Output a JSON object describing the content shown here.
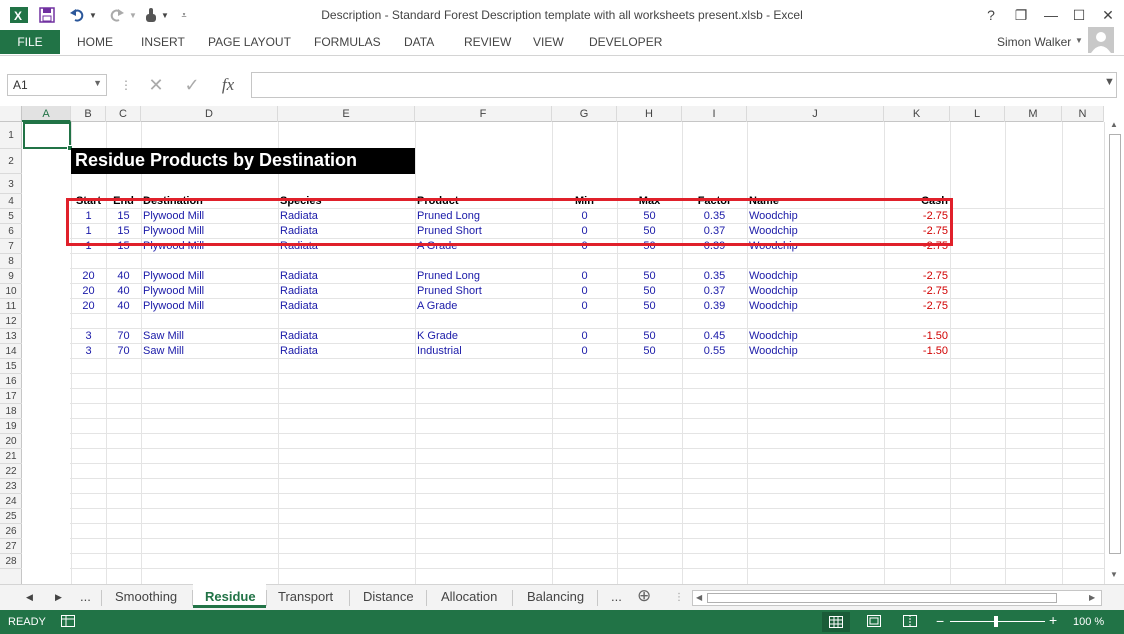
{
  "window": {
    "title": "Description - Standard Forest Description template with all worksheets present.xlsb - Excel",
    "help": "?",
    "restore_ribbon": "❐",
    "minimize": "—",
    "maximize": "☐",
    "close": "✕"
  },
  "ribbon": {
    "file": "FILE",
    "tabs": [
      "HOME",
      "INSERT",
      "PAGE LAYOUT",
      "FORMULAS",
      "DATA",
      "REVIEW",
      "VIEW",
      "DEVELOPER"
    ],
    "user": "Simon Walker"
  },
  "formula_bar": {
    "name_box": "A1",
    "fx": "fx",
    "formula": ""
  },
  "columns": [
    "A",
    "B",
    "C",
    "D",
    "E",
    "F",
    "G",
    "H",
    "I",
    "J",
    "K",
    "L",
    "M",
    "N"
  ],
  "rows": [
    "1",
    "2",
    "3",
    "4",
    "5",
    "6",
    "7",
    "8",
    "9",
    "10",
    "11",
    "12",
    "13",
    "14",
    "15",
    "16",
    "17",
    "18",
    "19",
    "20",
    "21",
    "22",
    "23",
    "24",
    "25",
    "26",
    "27",
    "28"
  ],
  "sheet": {
    "title": "Residue Products by Destination",
    "headers": {
      "start": "Start",
      "end": "End",
      "destination": "Destination",
      "species": "Species",
      "product": "Product",
      "min": "Min",
      "max": "Max",
      "factor": "Factor",
      "name": "Name",
      "cash": "Cash"
    },
    "data_rows": [
      {
        "start": "1",
        "end": "15",
        "destination": "Plywood Mill",
        "species": "Radiata",
        "product": "Pruned Long",
        "min": "0",
        "max": "50",
        "factor": "0.35",
        "name": "Woodchip",
        "cash": "-2.75"
      },
      {
        "start": "1",
        "end": "15",
        "destination": "Plywood Mill",
        "species": "Radiata",
        "product": "Pruned Short",
        "min": "0",
        "max": "50",
        "factor": "0.37",
        "name": "Woodchip",
        "cash": "-2.75"
      },
      {
        "start": "1",
        "end": "15",
        "destination": "Plywood Mill",
        "species": "Radiata",
        "product": "A Grade",
        "min": "0",
        "max": "50",
        "factor": "0.39",
        "name": "Woodchip",
        "cash": "-2.75"
      },
      {
        "start": "20",
        "end": "40",
        "destination": "Plywood Mill",
        "species": "Radiata",
        "product": "Pruned Long",
        "min": "0",
        "max": "50",
        "factor": "0.35",
        "name": "Woodchip",
        "cash": "-2.75"
      },
      {
        "start": "20",
        "end": "40",
        "destination": "Plywood Mill",
        "species": "Radiata",
        "product": "Pruned Short",
        "min": "0",
        "max": "50",
        "factor": "0.37",
        "name": "Woodchip",
        "cash": "-2.75"
      },
      {
        "start": "20",
        "end": "40",
        "destination": "Plywood Mill",
        "species": "Radiata",
        "product": "A Grade",
        "min": "0",
        "max": "50",
        "factor": "0.39",
        "name": "Woodchip",
        "cash": "-2.75"
      },
      {
        "start": "3",
        "end": "70",
        "destination": "Saw Mill",
        "species": "Radiata",
        "product": "K Grade",
        "min": "0",
        "max": "50",
        "factor": "0.45",
        "name": "Woodchip",
        "cash": "-1.50"
      },
      {
        "start": "3",
        "end": "70",
        "destination": "Saw Mill",
        "species": "Radiata",
        "product": "Industrial",
        "min": "0",
        "max": "50",
        "factor": "0.55",
        "name": "Woodchip",
        "cash": "-1.50"
      }
    ]
  },
  "sheet_tabs": {
    "prev": "◀",
    "next": "▶",
    "more_left": "...",
    "tabs": [
      "Smoothing",
      "Residue",
      "Transport",
      "Distance",
      "Allocation",
      "Balancing"
    ],
    "active": "Residue",
    "more_right": "...",
    "add": "⊕"
  },
  "status": {
    "ready": "READY",
    "zoom": "100 %",
    "zoom_minus": "−",
    "zoom_plus": "+"
  },
  "colors": {
    "accent": "#217346",
    "highlight": "#e0202a",
    "data_text": "#1a1aa8",
    "negative": "#d00000"
  }
}
